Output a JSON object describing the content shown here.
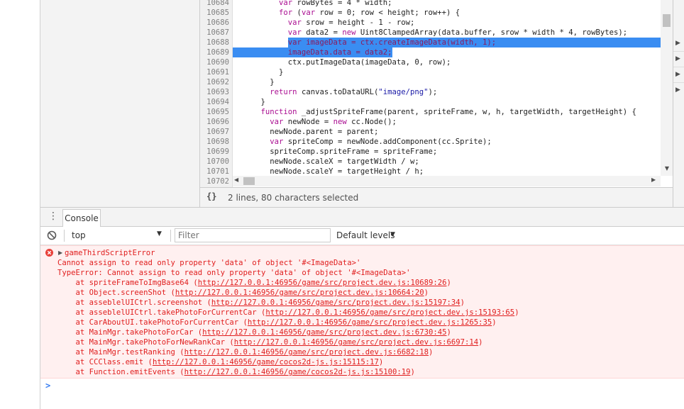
{
  "editor": {
    "lines": [
      {
        "num": "10684",
        "segments": [
          {
            "t": "        "
          },
          {
            "t": "var",
            "c": "kw"
          },
          {
            "t": " rowBytes = 4 * width;"
          }
        ]
      },
      {
        "num": "10685",
        "segments": [
          {
            "t": "        "
          },
          {
            "t": "for",
            "c": "kw"
          },
          {
            "t": " ("
          },
          {
            "t": "var",
            "c": "kw"
          },
          {
            "t": " row = 0; row < height; row++) {"
          }
        ]
      },
      {
        "num": "10686",
        "segments": [
          {
            "t": "          "
          },
          {
            "t": "var",
            "c": "kw"
          },
          {
            "t": " srow = height - 1 - row;"
          }
        ]
      },
      {
        "num": "10687",
        "segments": [
          {
            "t": "          "
          },
          {
            "t": "var",
            "c": "kw"
          },
          {
            "t": " data2 = "
          },
          {
            "t": "new",
            "c": "kw"
          },
          {
            "t": " Uint8ClampedArray(data.buffer, srow * width * 4, rowBytes);"
          }
        ]
      },
      {
        "num": "10688",
        "segments": [
          {
            "t": "          "
          },
          {
            "t": "var imageData = ctx.createImageData(width, 1);"
          }
        ]
      },
      {
        "num": "10689",
        "segments": [
          {
            "t": "          "
          },
          {
            "t": "imageData.data = data2;"
          }
        ]
      },
      {
        "num": "10690",
        "segments": [
          {
            "t": "          ctx.putImageData(imageData, 0, row);"
          }
        ]
      },
      {
        "num": "10691",
        "segments": [
          {
            "t": "        }"
          }
        ]
      },
      {
        "num": "10692",
        "segments": [
          {
            "t": "      }"
          }
        ]
      },
      {
        "num": "10693",
        "segments": [
          {
            "t": "      "
          },
          {
            "t": "return",
            "c": "kw"
          },
          {
            "t": " canvas.toDataURL("
          },
          {
            "t": "\"image/png\"",
            "c": "str"
          },
          {
            "t": ");"
          }
        ]
      },
      {
        "num": "10694",
        "segments": [
          {
            "t": "    }"
          }
        ]
      },
      {
        "num": "10695",
        "segments": [
          {
            "t": "    "
          },
          {
            "t": "function",
            "c": "kw"
          },
          {
            "t": " _adjustSpriteFrame(parent, spriteFrame, w, h, targetWidth, targetHeight) {"
          }
        ]
      },
      {
        "num": "10696",
        "segments": [
          {
            "t": "      "
          },
          {
            "t": "var",
            "c": "kw"
          },
          {
            "t": " newNode = "
          },
          {
            "t": "new",
            "c": "kw"
          },
          {
            "t": " cc.Node();"
          }
        ]
      },
      {
        "num": "10697",
        "segments": [
          {
            "t": "      newNode.parent = parent;"
          }
        ]
      },
      {
        "num": "10698",
        "segments": [
          {
            "t": "      "
          },
          {
            "t": "var",
            "c": "kw"
          },
          {
            "t": " spriteComp = newNode.addComponent(cc.Sprite);"
          }
        ]
      },
      {
        "num": "10699",
        "segments": [
          {
            "t": "      spriteComp.spriteFrame = spriteFrame;"
          }
        ]
      },
      {
        "num": "10700",
        "segments": [
          {
            "t": "      newNode.scaleX = targetWidth / w;"
          }
        ]
      },
      {
        "num": "10701",
        "segments": [
          {
            "t": "      newNode.scaleY = targetHeight / h;"
          }
        ]
      },
      {
        "num": "10702",
        "segments": [
          {
            "t": ""
          }
        ]
      }
    ],
    "selected_lines": [
      "10688",
      "10689"
    ]
  },
  "status": {
    "braces": "{}",
    "selection_text": "2 lines, 80 characters selected"
  },
  "drawer": {
    "tab_label": "Console"
  },
  "toolbar": {
    "context_value": "top",
    "filter_placeholder": "Filter",
    "levels_label": "Default levels"
  },
  "error": {
    "title": "gameThirdScriptError",
    "message_1": "Cannot assign to read only property 'data' of object '#<ImageData>'",
    "message_2": "TypeError: Cannot assign to read only property 'data' of object '#<ImageData>'",
    "stack": [
      {
        "fn": "at spriteFrameToImgBase64",
        "link": "http://127.0.0.1:46956/game/src/project.dev.js:10689:26"
      },
      {
        "fn": "at Object.screenShot",
        "link": "http://127.0.0.1:46956/game/src/project.dev.js:10664:20"
      },
      {
        "fn": "at asseblelUICtrl.screenshot",
        "link": "http://127.0.0.1:46956/game/src/project.dev.js:15197:34"
      },
      {
        "fn": "at asseblelUICtrl.takePhotoForCurrentCar",
        "link": "http://127.0.0.1:46956/game/src/project.dev.js:15193:65"
      },
      {
        "fn": "at CarAboutUI.takePhotoForCurrentCar",
        "link": "http://127.0.0.1:46956/game/src/project.dev.js:1265:35"
      },
      {
        "fn": "at MainMgr.takePhotoForCar",
        "link": "http://127.0.0.1:46956/game/src/project.dev.js:6730:45"
      },
      {
        "fn": "at MainMgr.takePhotoForNewRankCar",
        "link": "http://127.0.0.1:46956/game/src/project.dev.js:6697:14"
      },
      {
        "fn": "at MainMgr.testRanking",
        "link": "http://127.0.0.1:46956/game/src/project.dev.js:6682:18"
      },
      {
        "fn": "at CCClass.emit",
        "link": "http://127.0.0.1:46956/game/cocos2d-js.js:15115:17"
      },
      {
        "fn": "at Function.emitEvents",
        "link": "http://127.0.0.1:46956/game/cocos2d-js.js:15100:19"
      }
    ]
  },
  "prompt": ">"
}
